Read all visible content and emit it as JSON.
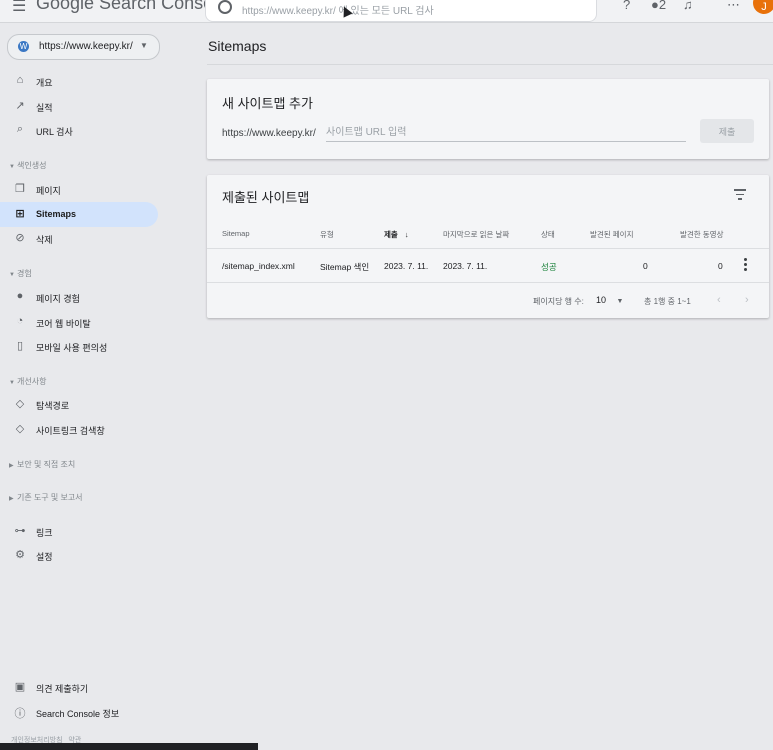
{
  "topbar": {
    "logo": "Google Search Console",
    "search_placeholder": "https://www.keepy.kr/ 에 있는 모든 URL 검사",
    "icons": [
      "menu-icon",
      "help-icon",
      "people-icon",
      "bell-icon",
      "apps-icon"
    ],
    "people_label": "2"
  },
  "property": {
    "url": "https://www.keepy.kr/",
    "icon": "wordpress-icon"
  },
  "nav": {
    "overview": "개요",
    "performance": "실적",
    "url_inspection": "URL 검사",
    "indexing_section": "색인생성",
    "pages": "페이지",
    "sitemaps": "Sitemaps",
    "removals": "삭제",
    "experience_section": "경험",
    "page_experience": "페이지 경험",
    "core_web_vitals": "코어 웹 바이탈",
    "mobile_usability": "모바일 사용 편의성",
    "enhancements_section": "개선사항",
    "breadcrumbs": "탐색경로",
    "sitelinks_searchbox": "사이트링크 검색창",
    "security_section": "보안 및 직접 조치",
    "legacy_section": "기존 도구 및 보고서",
    "links": "링크",
    "settings": "설정",
    "feedback": "의견 제출하기",
    "about": "Search Console 정보",
    "privacy": "개인정보처리방침",
    "terms": "약관"
  },
  "main": {
    "page_title": "Sitemaps",
    "add_card": {
      "title": "새 사이트맵 추가",
      "url_prefix": "https://www.keepy.kr/",
      "input_placeholder": "사이트맵 URL 입력",
      "submit_label": "제출"
    },
    "submitted_card": {
      "title": "제출된 사이트맵",
      "columns": {
        "sitemap": "Sitemap",
        "type": "유형",
        "submitted": "제출",
        "last_read": "마지막으로 읽은 날짜",
        "status": "상태",
        "discovered_pages": "발견된 페이지",
        "discovered_videos": "발견한 동영상"
      },
      "sort_indicator": "↓",
      "rows": [
        {
          "sitemap": "/sitemap_index.xml",
          "type": "Sitemap 색인",
          "submitted": "2023. 7. 11.",
          "last_read": "2023. 7. 11.",
          "status": "성공",
          "discovered_pages": "0",
          "discovered_videos": "0"
        }
      ],
      "pagination": {
        "rows_per_page_label": "페이지당 행 수:",
        "rows_per_page": "10",
        "range": "총 1행 중 1~1"
      }
    }
  },
  "colors": {
    "active_nav": "#d2e3fc",
    "success": "#188038",
    "avatar": "#e8710a"
  }
}
